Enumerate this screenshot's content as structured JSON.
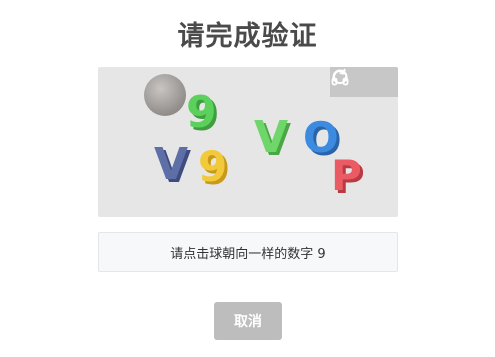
{
  "title": "请完成验证",
  "captcha": {
    "characters": [
      {
        "char": "9",
        "color": "#5bd15b"
      },
      {
        "char": "V",
        "color": "#5d6fa6"
      },
      {
        "char": "9",
        "color": "#f2c93a"
      },
      {
        "char": "V",
        "color": "#6fd66a"
      },
      {
        "char": "O",
        "color": "#3c8be0"
      },
      {
        "char": "P",
        "color": "#ea5b63"
      }
    ],
    "toolbar": {
      "refresh_icon": "refresh-icon",
      "audio_icon": "headphones-icon"
    }
  },
  "prompt": "请点击球朝向一样的数字 9",
  "cancel_label": "取消"
}
